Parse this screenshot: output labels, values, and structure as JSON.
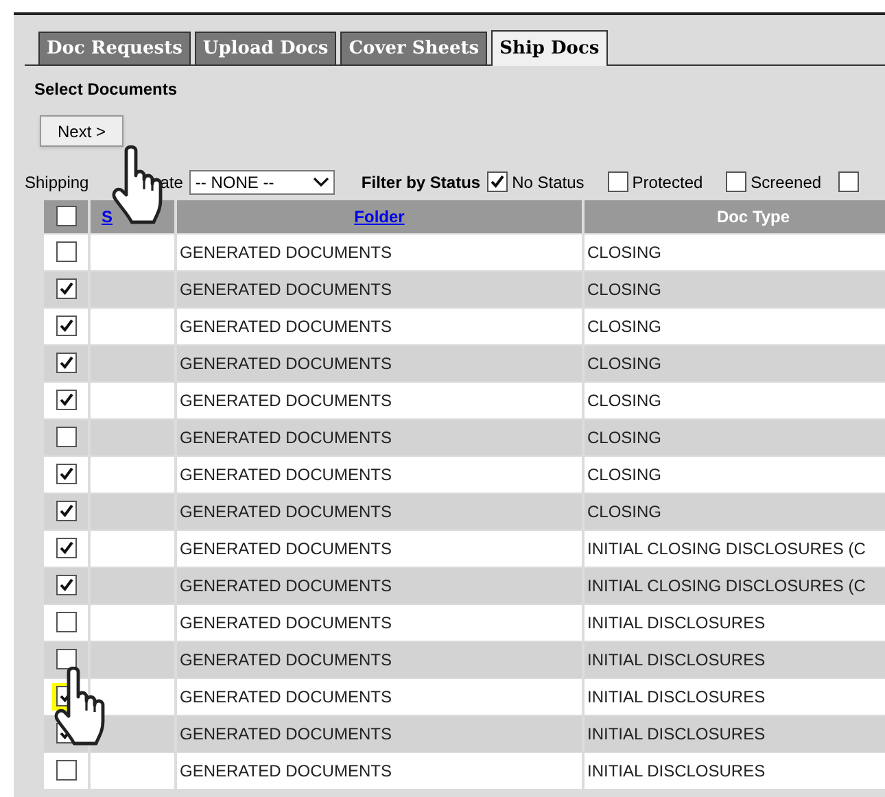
{
  "tabs": [
    {
      "label": "Doc Requests",
      "selected": false
    },
    {
      "label": "Upload Docs",
      "selected": false
    },
    {
      "label": "Cover Sheets",
      "selected": false
    },
    {
      "label": "Ship Docs",
      "selected": true
    }
  ],
  "section_title": "Select Documents",
  "next_button": "Next >",
  "filters": {
    "shipping_label_parts": [
      "Shipping",
      "ate"
    ],
    "template_select": "-- NONE --",
    "filter_label": "Filter by Status",
    "statuses": [
      {
        "label": "No Status",
        "checked": true
      },
      {
        "label": "Protected",
        "checked": false
      },
      {
        "label": "Screened",
        "checked": false
      }
    ],
    "partial_checkbox_checked": false
  },
  "table": {
    "select_all_checked": false,
    "columns": [
      "S",
      "Folder",
      "Doc Type"
    ],
    "rows": [
      {
        "checked": false,
        "highlighted": false,
        "folder": "GENERATED DOCUMENTS",
        "doc_type": "CLOSING"
      },
      {
        "checked": true,
        "highlighted": false,
        "folder": "GENERATED DOCUMENTS",
        "doc_type": "CLOSING"
      },
      {
        "checked": true,
        "highlighted": false,
        "folder": "GENERATED DOCUMENTS",
        "doc_type": "CLOSING"
      },
      {
        "checked": true,
        "highlighted": false,
        "folder": "GENERATED DOCUMENTS",
        "doc_type": "CLOSING"
      },
      {
        "checked": true,
        "highlighted": false,
        "folder": "GENERATED DOCUMENTS",
        "doc_type": "CLOSING"
      },
      {
        "checked": false,
        "highlighted": false,
        "folder": "GENERATED DOCUMENTS",
        "doc_type": "CLOSING"
      },
      {
        "checked": true,
        "highlighted": false,
        "folder": "GENERATED DOCUMENTS",
        "doc_type": "CLOSING"
      },
      {
        "checked": true,
        "highlighted": false,
        "folder": "GENERATED DOCUMENTS",
        "doc_type": "CLOSING"
      },
      {
        "checked": true,
        "highlighted": false,
        "folder": "GENERATED DOCUMENTS",
        "doc_type": "INITIAL CLOSING DISCLOSURES (C"
      },
      {
        "checked": true,
        "highlighted": false,
        "folder": "GENERATED DOCUMENTS",
        "doc_type": "INITIAL CLOSING DISCLOSURES (C"
      },
      {
        "checked": false,
        "highlighted": false,
        "folder": "GENERATED DOCUMENTS",
        "doc_type": "INITIAL DISCLOSURES"
      },
      {
        "checked": false,
        "highlighted": false,
        "folder": "GENERATED DOCUMENTS",
        "doc_type": "INITIAL DISCLOSURES"
      },
      {
        "checked": true,
        "highlighted": true,
        "folder": "GENERATED DOCUMENTS",
        "doc_type": "INITIAL DISCLOSURES"
      },
      {
        "checked": true,
        "highlighted": false,
        "folder": "GENERATED DOCUMENTS",
        "doc_type": "INITIAL DISCLOSURES"
      },
      {
        "checked": false,
        "highlighted": false,
        "folder": "GENERATED DOCUMENTS",
        "doc_type": "INITIAL DISCLOSURES"
      }
    ]
  }
}
